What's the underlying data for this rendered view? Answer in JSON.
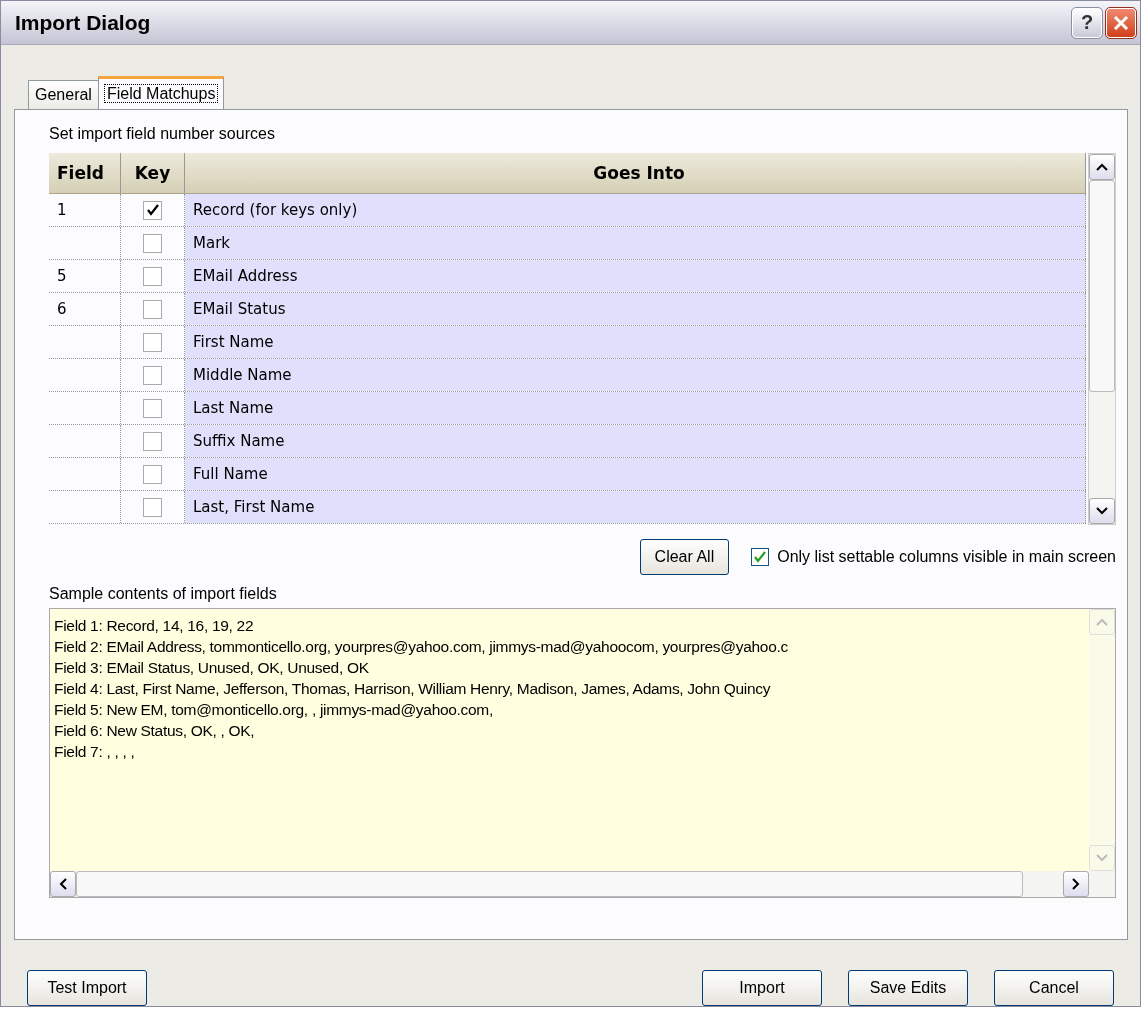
{
  "window": {
    "title": "Import Dialog",
    "help_button": "?"
  },
  "tabs": [
    {
      "label": "General",
      "selected": false
    },
    {
      "label": "Field Matchups",
      "selected": true
    }
  ],
  "matchups": {
    "caption": "Set import field number sources",
    "columns": [
      "Field",
      "Key",
      "Goes Into"
    ],
    "rows": [
      {
        "field": "1",
        "key": true,
        "goes_into": "Record (for keys only)"
      },
      {
        "key": false,
        "goes_into": "Mark"
      },
      {
        "field": "5",
        "key": false,
        "goes_into": "EMail Address"
      },
      {
        "field": "6",
        "key": false,
        "goes_into": "EMail Status"
      },
      {
        "key": false,
        "goes_into": "First Name"
      },
      {
        "key": false,
        "goes_into": "Middle Name"
      },
      {
        "key": false,
        "goes_into": "Last Name"
      },
      {
        "key": false,
        "goes_into": "Suffix Name"
      },
      {
        "key": false,
        "goes_into": "Full Name"
      },
      {
        "key": false,
        "goes_into": "Last, First Name"
      }
    ]
  },
  "clear_all": "Clear All",
  "only_visible": {
    "label": "Only list settable columns visible in main screen",
    "checked": true
  },
  "sample": {
    "caption": "Sample contents of import fields",
    "lines": [
      "Field 1: Record, 14, 16, 19, 22",
      "Field 2: EMail Address, tommonticello.org, yourpres@yahoo.com, jimmys-mad@yahoocom, yourpres@yahoo.c",
      "Field 3: EMail Status, Unused, OK, Unused, OK",
      "Field 4: Last, First Name, Jefferson, Thomas, Harrison, William Henry, Madison, James, Adams, John Quincy",
      "Field 5: New EM, tom@monticello.org, , jimmys-mad@yahoo.com,",
      "Field 6: New Status, OK, , OK,",
      "Field 7: , , , ,"
    ]
  },
  "buttons": {
    "test": "Test Import",
    "import": "Import",
    "save": "Save Edits",
    "cancel": "Cancel"
  }
}
